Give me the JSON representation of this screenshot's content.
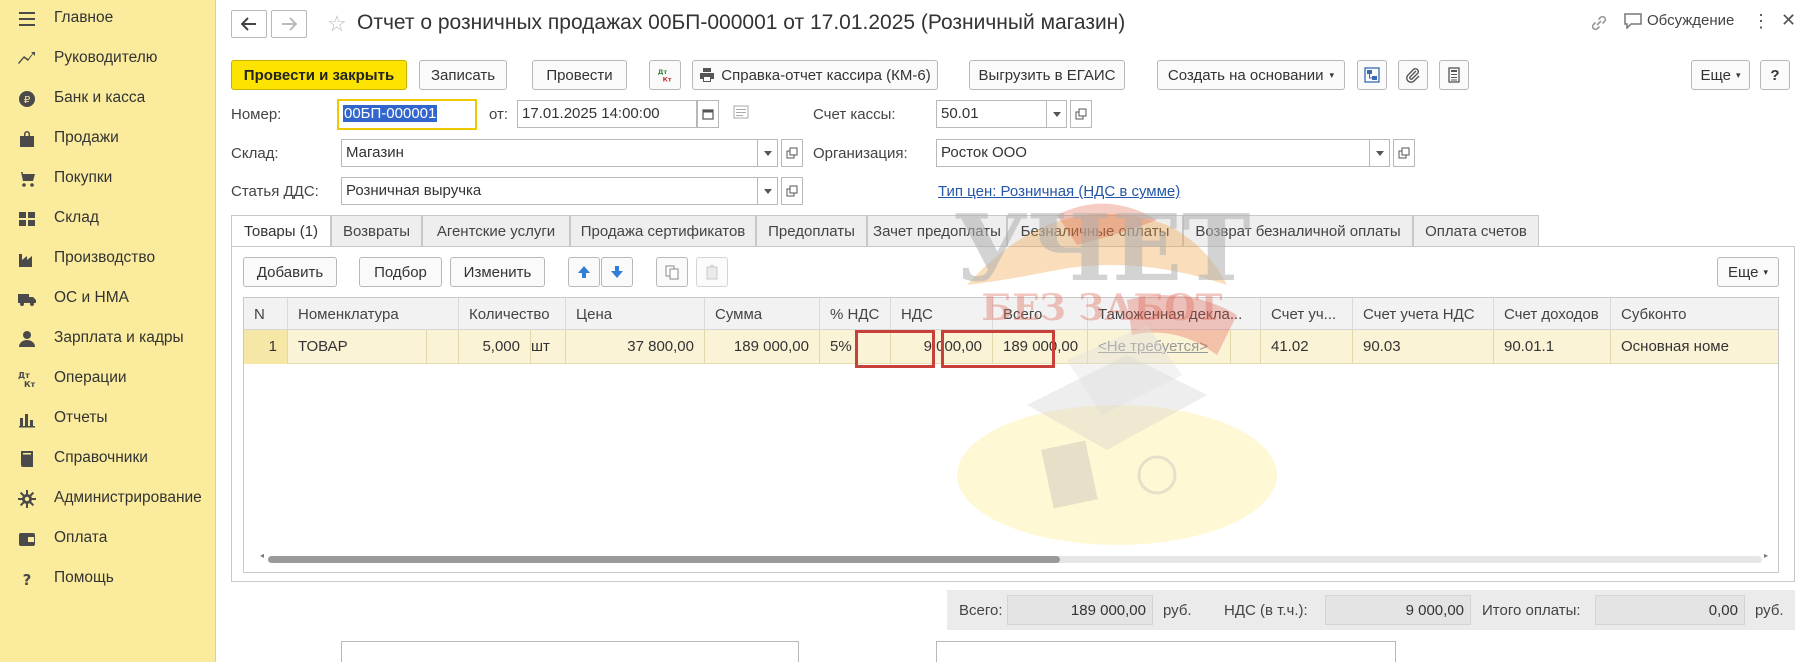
{
  "sidebar": {
    "items": [
      {
        "label": "Главное",
        "icon": "menu-icon"
      },
      {
        "label": "Руководителю",
        "icon": "trend-icon"
      },
      {
        "label": "Банк и касса",
        "icon": "coin-icon"
      },
      {
        "label": "Продажи",
        "icon": "bag-icon"
      },
      {
        "label": "Покупки",
        "icon": "cart-icon"
      },
      {
        "label": "Склад",
        "icon": "warehouse-icon"
      },
      {
        "label": "Производство",
        "icon": "factory-icon"
      },
      {
        "label": "ОС и НМА",
        "icon": "truck-icon"
      },
      {
        "label": "Зарплата и кадры",
        "icon": "person-icon"
      },
      {
        "label": "Операции",
        "icon": "dt-kt-icon"
      },
      {
        "label": "Отчеты",
        "icon": "bar-chart-icon"
      },
      {
        "label": "Справочники",
        "icon": "book-icon"
      },
      {
        "label": "Администрирование",
        "icon": "gear-icon"
      },
      {
        "label": "Оплата",
        "icon": "wallet-icon"
      },
      {
        "label": "Помощь",
        "icon": "question-icon"
      }
    ]
  },
  "header": {
    "title": "Отчет о розничных продажах 00БП-000001 от 17.01.2025 (Розничный магазин)",
    "discuss_label": "Обсуждение"
  },
  "toolbar": {
    "post_close": "Провести и закрыть",
    "save": "Записать",
    "post": "Провести",
    "dtkt_top": "Дт",
    "dtkt_bottom": "Кт",
    "cashier_report": "Справка-отчет кассира (КМ-6)",
    "egais": "Выгрузить в ЕГАИС",
    "create_based": "Создать на основании",
    "more": "Еще",
    "help": "?"
  },
  "form": {
    "number_label": "Номер:",
    "number_value": "00БП-000001",
    "date_label": "от:",
    "date_value": "17.01.2025 14:00:00",
    "cash_account_label": "Счет кассы:",
    "cash_account_value": "50.01",
    "warehouse_label": "Склад:",
    "warehouse_value": "Магазин",
    "org_label": "Организация:",
    "org_value": "Росток ООО",
    "dds_label": "Статья ДДС:",
    "dds_value": "Розничная выручка",
    "price_type_link": "Тип цен: Розничная (НДС в сумме)"
  },
  "tabs": [
    {
      "label": "Товары (1)"
    },
    {
      "label": "Возвраты"
    },
    {
      "label": "Агентские услуги"
    },
    {
      "label": "Продажа сертификатов"
    },
    {
      "label": "Предоплаты"
    },
    {
      "label": "Зачет предоплаты"
    },
    {
      "label": "Безналичные оплаты"
    },
    {
      "label": "Возврат безналичной оплаты"
    },
    {
      "label": "Оплата счетов"
    }
  ],
  "table_toolbar": {
    "add": "Добавить",
    "pick": "Подбор",
    "edit": "Изменить",
    "more": "Еще"
  },
  "table": {
    "headers": [
      "N",
      "Номенклатура",
      "Количество",
      "Цена",
      "Сумма",
      "% НДС",
      "НДС",
      "Всего",
      "Таможенная декла...",
      "Счет уч...",
      "Счет учета НДС",
      "Счет доходов",
      "Субконто"
    ],
    "rows": [
      {
        "n": "1",
        "item": "ТОВАР",
        "qty": "5,000",
        "unit": "шт",
        "price": "37 800,00",
        "sum": "189 000,00",
        "vat_rate": "5%",
        "vat": "9 000,00",
        "total": "189 000,00",
        "customs": "<Не требуется>",
        "account": "41.02",
        "vat_account": "90.03",
        "income_account": "90.01.1",
        "subconto": "Основная номе"
      }
    ]
  },
  "totals": {
    "total_label": "Всего:",
    "total_value": "189 000,00",
    "currency1": "руб.",
    "vat_label": "НДС (в т.ч.):",
    "vat_value": "9 000,00",
    "paid_label": "Итого оплаты:",
    "paid_value": "0,00",
    "currency2": "руб."
  },
  "watermark": {
    "line1": "УЧЕТ",
    "line2": "БЕЗ ЗАБОТ"
  },
  "colors": {
    "sidebar_bg": "#fbec9d",
    "primary_button": "#fce300",
    "row_highlight": "#fbf3d6",
    "callout_red": "#c8403a",
    "link": "#2457a8"
  }
}
